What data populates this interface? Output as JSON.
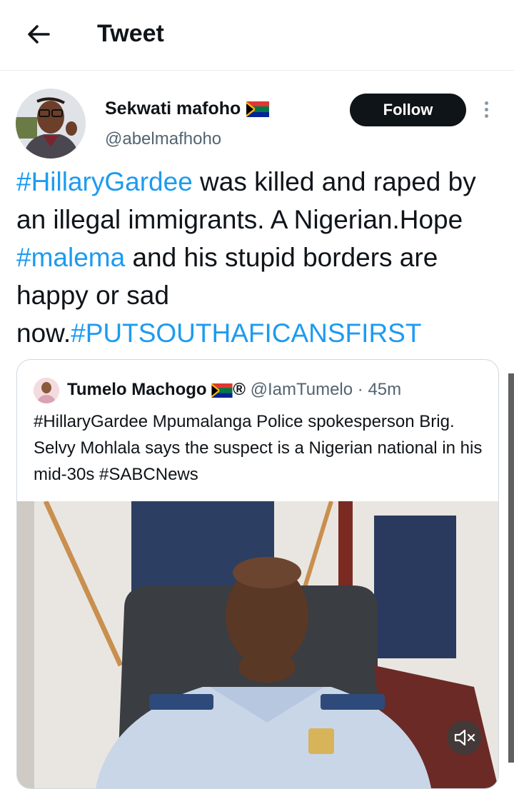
{
  "header": {
    "title": "Tweet",
    "back_icon": "arrow-left-icon"
  },
  "tweet": {
    "author_name": "Sekwati mafoho",
    "author_flag": "south-africa-flag-icon",
    "author_handle": "@abelmafhoho",
    "follow_label": "Follow",
    "text_parts": {
      "tag1": "#HillaryGardee",
      "t1": " was killed and raped by an illegal immigrants. A Nigerian.Hope ",
      "tag2": "#malema",
      "t2": " and his stupid borders are happy or sad now.",
      "tag3": "#PUTSOUTHAFICANSFIRST"
    }
  },
  "quote": {
    "author_name": "Tumelo Machogo",
    "author_flag": "south-africa-flag-icon",
    "registered": "®",
    "author_handle": "@IamTumelo",
    "separator": "·",
    "time": "45m",
    "text": "#HillaryGardee Mpumalanga Police spokesperson Brig. Selvy Mohlala says the suspect is a Nigerian national in his mid-30s #SABCNews",
    "media_icon": "mute-icon"
  },
  "colors": {
    "link": "#1d9bf0",
    "text": "#0f1419",
    "secondary": "#536471",
    "follow_bg": "#0f1419"
  }
}
